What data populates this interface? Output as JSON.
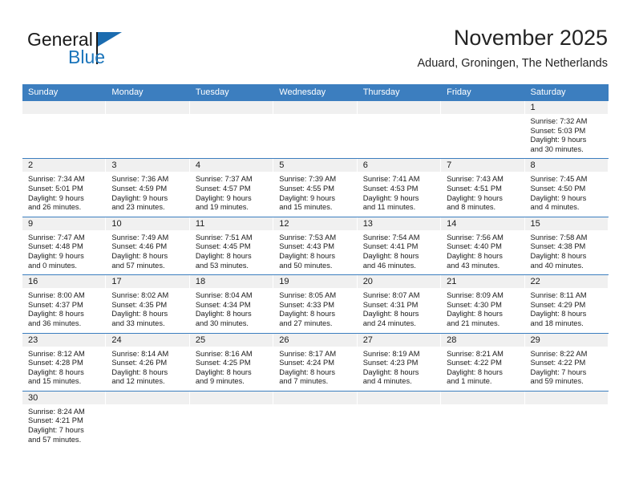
{
  "brand": {
    "name_top": "General",
    "name_bottom": "Blue",
    "accent_color": "#1b75bb",
    "flag_color": "#1b6cb0"
  },
  "header": {
    "title": "November 2025",
    "subtitle": "Aduard, Groningen, The Netherlands"
  },
  "calendar": {
    "header_color": "#3c7ebf",
    "daynum_band_color": "#f0f0f0",
    "weekdays": [
      "Sunday",
      "Monday",
      "Tuesday",
      "Wednesday",
      "Thursday",
      "Friday",
      "Saturday"
    ],
    "weeks": [
      [
        {
          "day": "",
          "lines": []
        },
        {
          "day": "",
          "lines": []
        },
        {
          "day": "",
          "lines": []
        },
        {
          "day": "",
          "lines": []
        },
        {
          "day": "",
          "lines": []
        },
        {
          "day": "",
          "lines": []
        },
        {
          "day": "1",
          "lines": [
            "Sunrise: 7:32 AM",
            "Sunset: 5:03 PM",
            "Daylight: 9 hours",
            "and 30 minutes."
          ]
        }
      ],
      [
        {
          "day": "2",
          "lines": [
            "Sunrise: 7:34 AM",
            "Sunset: 5:01 PM",
            "Daylight: 9 hours",
            "and 26 minutes."
          ]
        },
        {
          "day": "3",
          "lines": [
            "Sunrise: 7:36 AM",
            "Sunset: 4:59 PM",
            "Daylight: 9 hours",
            "and 23 minutes."
          ]
        },
        {
          "day": "4",
          "lines": [
            "Sunrise: 7:37 AM",
            "Sunset: 4:57 PM",
            "Daylight: 9 hours",
            "and 19 minutes."
          ]
        },
        {
          "day": "5",
          "lines": [
            "Sunrise: 7:39 AM",
            "Sunset: 4:55 PM",
            "Daylight: 9 hours",
            "and 15 minutes."
          ]
        },
        {
          "day": "6",
          "lines": [
            "Sunrise: 7:41 AM",
            "Sunset: 4:53 PM",
            "Daylight: 9 hours",
            "and 11 minutes."
          ]
        },
        {
          "day": "7",
          "lines": [
            "Sunrise: 7:43 AM",
            "Sunset: 4:51 PM",
            "Daylight: 9 hours",
            "and 8 minutes."
          ]
        },
        {
          "day": "8",
          "lines": [
            "Sunrise: 7:45 AM",
            "Sunset: 4:50 PM",
            "Daylight: 9 hours",
            "and 4 minutes."
          ]
        }
      ],
      [
        {
          "day": "9",
          "lines": [
            "Sunrise: 7:47 AM",
            "Sunset: 4:48 PM",
            "Daylight: 9 hours",
            "and 0 minutes."
          ]
        },
        {
          "day": "10",
          "lines": [
            "Sunrise: 7:49 AM",
            "Sunset: 4:46 PM",
            "Daylight: 8 hours",
            "and 57 minutes."
          ]
        },
        {
          "day": "11",
          "lines": [
            "Sunrise: 7:51 AM",
            "Sunset: 4:45 PM",
            "Daylight: 8 hours",
            "and 53 minutes."
          ]
        },
        {
          "day": "12",
          "lines": [
            "Sunrise: 7:53 AM",
            "Sunset: 4:43 PM",
            "Daylight: 8 hours",
            "and 50 minutes."
          ]
        },
        {
          "day": "13",
          "lines": [
            "Sunrise: 7:54 AM",
            "Sunset: 4:41 PM",
            "Daylight: 8 hours",
            "and 46 minutes."
          ]
        },
        {
          "day": "14",
          "lines": [
            "Sunrise: 7:56 AM",
            "Sunset: 4:40 PM",
            "Daylight: 8 hours",
            "and 43 minutes."
          ]
        },
        {
          "day": "15",
          "lines": [
            "Sunrise: 7:58 AM",
            "Sunset: 4:38 PM",
            "Daylight: 8 hours",
            "and 40 minutes."
          ]
        }
      ],
      [
        {
          "day": "16",
          "lines": [
            "Sunrise: 8:00 AM",
            "Sunset: 4:37 PM",
            "Daylight: 8 hours",
            "and 36 minutes."
          ]
        },
        {
          "day": "17",
          "lines": [
            "Sunrise: 8:02 AM",
            "Sunset: 4:35 PM",
            "Daylight: 8 hours",
            "and 33 minutes."
          ]
        },
        {
          "day": "18",
          "lines": [
            "Sunrise: 8:04 AM",
            "Sunset: 4:34 PM",
            "Daylight: 8 hours",
            "and 30 minutes."
          ]
        },
        {
          "day": "19",
          "lines": [
            "Sunrise: 8:05 AM",
            "Sunset: 4:33 PM",
            "Daylight: 8 hours",
            "and 27 minutes."
          ]
        },
        {
          "day": "20",
          "lines": [
            "Sunrise: 8:07 AM",
            "Sunset: 4:31 PM",
            "Daylight: 8 hours",
            "and 24 minutes."
          ]
        },
        {
          "day": "21",
          "lines": [
            "Sunrise: 8:09 AM",
            "Sunset: 4:30 PM",
            "Daylight: 8 hours",
            "and 21 minutes."
          ]
        },
        {
          "day": "22",
          "lines": [
            "Sunrise: 8:11 AM",
            "Sunset: 4:29 PM",
            "Daylight: 8 hours",
            "and 18 minutes."
          ]
        }
      ],
      [
        {
          "day": "23",
          "lines": [
            "Sunrise: 8:12 AM",
            "Sunset: 4:28 PM",
            "Daylight: 8 hours",
            "and 15 minutes."
          ]
        },
        {
          "day": "24",
          "lines": [
            "Sunrise: 8:14 AM",
            "Sunset: 4:26 PM",
            "Daylight: 8 hours",
            "and 12 minutes."
          ]
        },
        {
          "day": "25",
          "lines": [
            "Sunrise: 8:16 AM",
            "Sunset: 4:25 PM",
            "Daylight: 8 hours",
            "and 9 minutes."
          ]
        },
        {
          "day": "26",
          "lines": [
            "Sunrise: 8:17 AM",
            "Sunset: 4:24 PM",
            "Daylight: 8 hours",
            "and 7 minutes."
          ]
        },
        {
          "day": "27",
          "lines": [
            "Sunrise: 8:19 AM",
            "Sunset: 4:23 PM",
            "Daylight: 8 hours",
            "and 4 minutes."
          ]
        },
        {
          "day": "28",
          "lines": [
            "Sunrise: 8:21 AM",
            "Sunset: 4:22 PM",
            "Daylight: 8 hours",
            "and 1 minute."
          ]
        },
        {
          "day": "29",
          "lines": [
            "Sunrise: 8:22 AM",
            "Sunset: 4:22 PM",
            "Daylight: 7 hours",
            "and 59 minutes."
          ]
        }
      ],
      [
        {
          "day": "30",
          "lines": [
            "Sunrise: 8:24 AM",
            "Sunset: 4:21 PM",
            "Daylight: 7 hours",
            "and 57 minutes."
          ]
        },
        {
          "day": "",
          "lines": []
        },
        {
          "day": "",
          "lines": []
        },
        {
          "day": "",
          "lines": []
        },
        {
          "day": "",
          "lines": []
        },
        {
          "day": "",
          "lines": []
        },
        {
          "day": "",
          "lines": []
        }
      ]
    ]
  }
}
